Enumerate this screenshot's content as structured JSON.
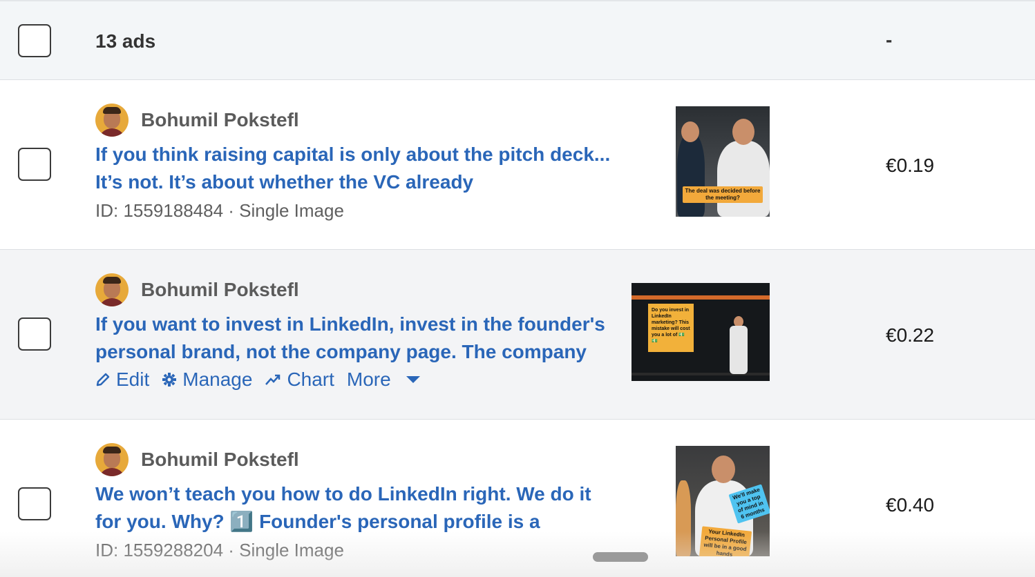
{
  "summary": {
    "count_label": "13 ads",
    "value": "-"
  },
  "ads": [
    {
      "author": "Bohumil Pokstefl",
      "text": "If you think raising capital is only about the pitch deck... It’s not. It’s about whether the VC already",
      "meta": "ID: 1559188484 · Single Image",
      "price": "€0.19",
      "thumb_caption": "The deal was decided before the meeting?"
    },
    {
      "author": "Bohumil Pokstefl",
      "text": "If you want to invest in LinkedIn, invest in the founder's personal brand, not the company page. The company",
      "actions": {
        "edit": "Edit",
        "manage": "Manage",
        "chart": "Chart",
        "more": "More"
      },
      "price": "€0.22",
      "thumb_caption": "Do you invest in LinkedIn marketing? This mistake will cost you a lot of 💵💵"
    },
    {
      "author": "Bohumil Pokstefl",
      "text": "We won’t teach you how to do LinkedIn right. We do it for you. Why? 1️⃣ Founder's personal profile is a",
      "meta": "ID: 1559288204 · Single Image",
      "price": "€0.40",
      "thumb_caption": "Your LinkedIn Personal Profile will be in a good hands",
      "thumb_badge": "We'll make you a top of mind in 6 months"
    }
  ],
  "colors": {
    "link": "#2a66b8",
    "accent_tag": "#f2a93b",
    "row_alt": "#f3f4f6"
  }
}
